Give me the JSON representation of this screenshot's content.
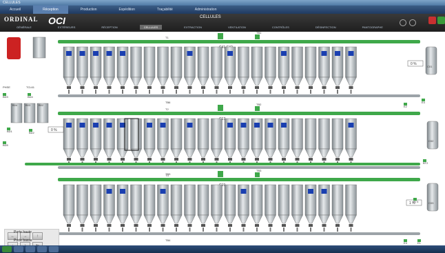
{
  "window": {
    "title": "CELLULES"
  },
  "tabs": [
    "Accueil",
    "Réception",
    "Production",
    "Expédition",
    "Traçabilité",
    "Administration"
  ],
  "selected_tab": 1,
  "tab_right": "",
  "brand": {
    "name": "ORDINAL",
    "mark": "OCI"
  },
  "page_title": "CELLULES",
  "subnav": [
    "GÉNÉRALE",
    "EXTÉRIEURS",
    "RÉCEPTION",
    "CELLULES",
    "EXTRACTION",
    "VENTILATION",
    "CONTRÔLES",
    "DÉSINFECTION",
    "PANTOGRAPHE"
  ],
  "selected_subnav": 3,
  "rows": [
    {
      "feed": "T1",
      "feed2": "TB1",
      "label": "C41 C42",
      "bottom": "TB6",
      "count": 22,
      "blue": [
        1,
        2,
        3,
        4,
        5,
        10,
        13,
        17,
        20,
        21,
        22
      ]
    },
    {
      "feed": "T2",
      "feed2": "TB2",
      "label": "C17",
      "bottom": "TB3",
      "count": 22,
      "blue": [
        1,
        2,
        3,
        4,
        5,
        7,
        8,
        10,
        13,
        14,
        15,
        16,
        17,
        22
      ]
    },
    {
      "feed": "T3",
      "feed2": "TB3",
      "label": "C19",
      "bottom": "TB4",
      "count": 22,
      "blue": [
        4,
        5,
        8,
        14,
        19,
        20
      ]
    }
  ],
  "tanks": [
    "PHSE",
    "TCL61",
    "B04",
    "B03",
    "B02",
    "BD3",
    "C01",
    "C02",
    "C03"
  ],
  "levels": [
    "0 %",
    "0 %",
    "1 %"
  ],
  "valves": [
    "BD3",
    "BD4",
    "BD1",
    "BD2",
    "BD5",
    "BT3",
    "BT2",
    "E2",
    "E4",
    "E3",
    "E1"
  ],
  "buttons": [
    "←",
    "→",
    "↑",
    "↓",
    "↕",
    "⇆"
  ],
  "porte": {
    "haute": "Porte haute",
    "basse": "Porte basse"
  },
  "taskbar_time": "",
  "colors": {
    "green": "#3fa84a",
    "grey": "#9ca3a8",
    "blue": "#1a3fb0",
    "red": "#cc2222"
  }
}
